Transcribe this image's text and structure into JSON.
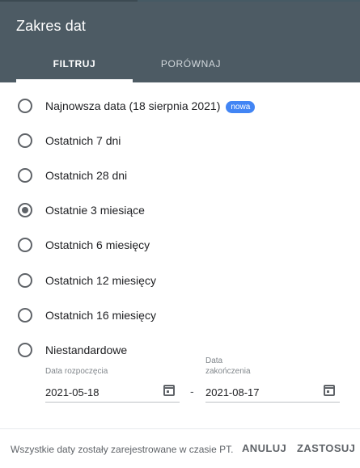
{
  "dialog": {
    "title": "Zakres dat",
    "tabs": [
      "FILTRUJ",
      "PORÓWNAJ"
    ],
    "active_tab": "FILTRUJ"
  },
  "options": [
    {
      "label": "Najnowsza data (18 sierpnia 2021)",
      "badge": "nowa",
      "selected": false
    },
    {
      "label": "Ostatnich 7 dni",
      "selected": false
    },
    {
      "label": "Ostatnich 28 dni",
      "selected": false
    },
    {
      "label": "Ostatnie 3 miesiące",
      "selected": true
    },
    {
      "label": "Ostatnich 6 miesięcy",
      "selected": false
    },
    {
      "label": "Ostatnich 12 miesięcy",
      "selected": false
    },
    {
      "label": "Ostatnich 16 miesięcy",
      "selected": false
    },
    {
      "label": "Niestandardowe",
      "selected": false
    }
  ],
  "custom_range": {
    "start_label": "Data rozpoczęcia",
    "start_value": "2021-05-18",
    "end_label_line1": "Data",
    "end_label_line2": "zakończenia",
    "end_value": "2021-08-17",
    "separator": "-"
  },
  "footer": {
    "note": "Wszystkie daty zostały zarejestrowane w czasie PT.",
    "cancel_label": "ANULUJ",
    "apply_label": "ZASTOSUJ"
  },
  "colors": {
    "header_bg": "#4d5b64",
    "badge_bg": "#4285f4"
  },
  "icons": [
    "calendar-icon"
  ]
}
